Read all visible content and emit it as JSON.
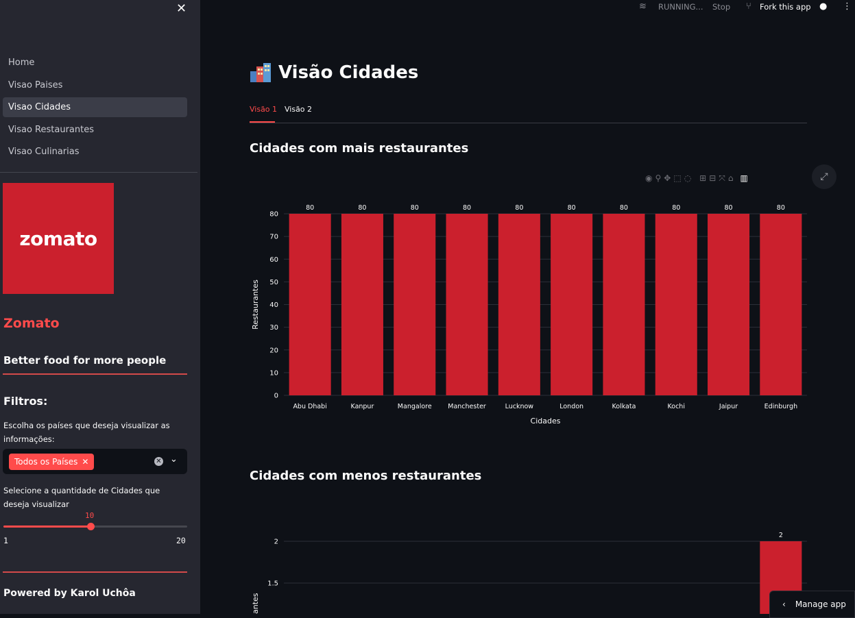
{
  "sidebar": {
    "nav": [
      {
        "label": "Home",
        "active": false
      },
      {
        "label": "Visao Paises",
        "active": false
      },
      {
        "label": "Visao Cidades",
        "active": true
      },
      {
        "label": "Visao Restaurantes",
        "active": false
      },
      {
        "label": "Visao Culinarias",
        "active": false
      }
    ],
    "logo_text": "zomato",
    "brand": "Zomato",
    "tagline": "Better food for more people",
    "filters_heading": "Filtros:",
    "countries_label": "Escolha os países que deseja visualizar as informações:",
    "selected_country_tag": "Todos os Países",
    "cities_label": "Selecione a quantidade de Cidades que deseja visualizar",
    "slider": {
      "value": "10",
      "min": "1",
      "max": "20",
      "fraction": 0.4737
    },
    "powered_by": "Powered by Karol Uchôa"
  },
  "topbar": {
    "running": "RUNNING...",
    "stop": "Stop",
    "fork": "Fork this app"
  },
  "main": {
    "title": "Visão Cidades",
    "tabs": [
      "Visão 1",
      "Visão 2"
    ],
    "section1_title": "Cidades com mais restaurantes",
    "section2_title": "Cidades com menos restaurantes"
  },
  "manage_app": "Manage app",
  "colors": {
    "accent": "#ff4b4b",
    "bar": "#cb202d",
    "logo_bg": "#cb202d"
  },
  "chart_data": [
    {
      "type": "bar",
      "title": "Cidades com mais restaurantes",
      "categories": [
        "Abu Dhabi",
        "Kanpur",
        "Mangalore",
        "Manchester",
        "Lucknow",
        "London",
        "Kolkata",
        "Kochi",
        "Jaipur",
        "Edinburgh"
      ],
      "values": [
        80,
        80,
        80,
        80,
        80,
        80,
        80,
        80,
        80,
        80
      ],
      "xlabel": "Cidades",
      "ylabel": "Restaurantes",
      "ylim": [
        0,
        80
      ],
      "yticks": [
        "0",
        "10",
        "20",
        "30",
        "40",
        "50",
        "60",
        "70",
        "80"
      ],
      "grid": true
    },
    {
      "type": "bar",
      "title": "Cidades com menos restaurantes",
      "visible_values": [
        2
      ],
      "ylabel_partial": "antes",
      "yticks": [
        "1.5",
        "2"
      ],
      "grid": true
    }
  ]
}
